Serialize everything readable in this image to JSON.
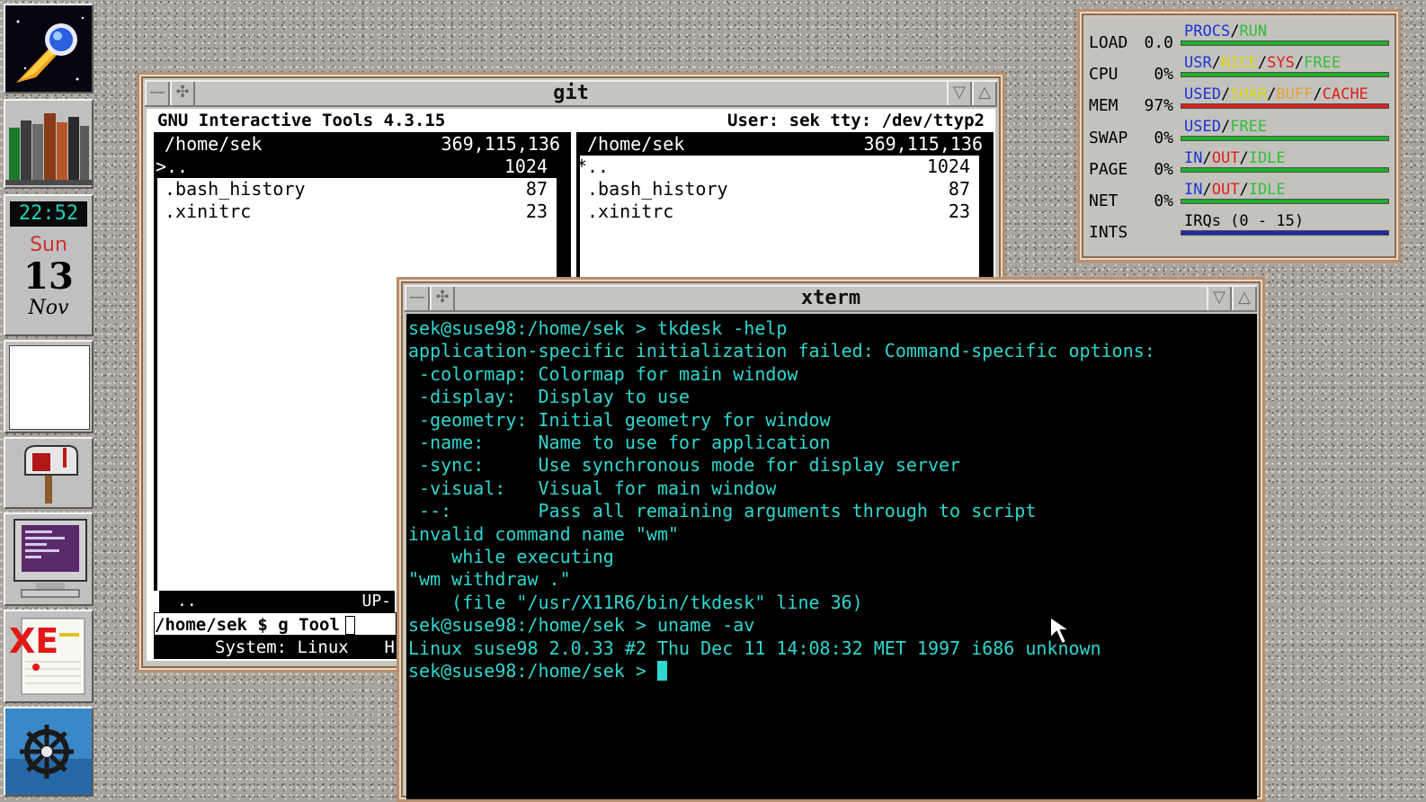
{
  "dock": {
    "clock_time": "22:52",
    "calendar": {
      "day": "Sun",
      "date": "13",
      "month": "Nov"
    },
    "icons": [
      "comet-icon",
      "books-icon",
      "clock-icon",
      "blank-tile",
      "mailbox-icon",
      "monitor-icon",
      "xemacs-icon",
      "ship-wheel-icon"
    ]
  },
  "git_window": {
    "title": "git",
    "header_left": "GNU Interactive Tools 4.3.15",
    "header_right": "User: sek  tty: /dev/ttyp2",
    "left_panel": {
      "path": "/home/sek",
      "size": "369,115,136",
      "marker": ">",
      "files": [
        {
          "name": "..",
          "size": "1024"
        },
        {
          "name": ".bash_history",
          "size": "87"
        },
        {
          "name": ".xinitrc",
          "size": "23"
        }
      ],
      "footer_left": "..",
      "footer_right": "UP-"
    },
    "right_panel": {
      "path": "/home/sek",
      "size": "369,115,136",
      "marker": "*",
      "files": [
        {
          "name": "..",
          "size": "1024"
        },
        {
          "name": ".bash_history",
          "size": "87"
        },
        {
          "name": ".xinitrc",
          "size": "23"
        }
      ]
    },
    "command_line": "/home/sek $ g Tool",
    "status_line": "System: Linux",
    "status_tail": "H"
  },
  "xterm_window": {
    "title": "xterm",
    "lines": [
      "sek@suse98:/home/sek > tkdesk -help",
      "application-specific initialization failed: Command-specific options:",
      " -colormap: Colormap for main window",
      " -display:  Display to use",
      " -geometry: Initial geometry for window",
      " -name:     Name to use for application",
      " -sync:     Use synchronous mode for display server",
      " -visual:   Visual for main window",
      " --:        Pass all remaining arguments through to script",
      "invalid command name \"wm\"",
      "    while executing",
      "\"wm withdraw .\"",
      "    (file \"/usr/X11R6/bin/tkdesk\" line 36)",
      "sek@suse98:/home/sek > uname -av",
      "Linux suse98 2.0.33 #2 Thu Dec 11 14:08:32 MET 1997 i686 unknown"
    ],
    "prompt": "sek@suse98:/home/sek > "
  },
  "monitor": {
    "rows": [
      {
        "label": "LOAD",
        "value": "0.0",
        "legend": [
          {
            "t": "PROCS",
            "c": "#1b34d6"
          },
          {
            "t": "/",
            "c": "#000000"
          },
          {
            "t": "RUN",
            "c": "#2fbf3a"
          }
        ],
        "bar": "#1db02d"
      },
      {
        "label": "CPU",
        "value": "0%",
        "legend": [
          {
            "t": "USR",
            "c": "#1b34d6"
          },
          {
            "t": "/",
            "c": "#000000"
          },
          {
            "t": "NICE",
            "c": "#d8d818"
          },
          {
            "t": "/",
            "c": "#000000"
          },
          {
            "t": "SYS",
            "c": "#e0201e"
          },
          {
            "t": "/",
            "c": "#000000"
          },
          {
            "t": "FREE",
            "c": "#2fbf3a"
          }
        ],
        "bar": "#1db02d"
      },
      {
        "label": "MEM",
        "value": "97%",
        "legend": [
          {
            "t": "USED",
            "c": "#1b34d6"
          },
          {
            "t": "/",
            "c": "#000000"
          },
          {
            "t": "SHAR",
            "c": "#d8d818"
          },
          {
            "t": "/",
            "c": "#000000"
          },
          {
            "t": "BUFF",
            "c": "#e2a23a"
          },
          {
            "t": "/",
            "c": "#000000"
          },
          {
            "t": "CACHE",
            "c": "#e0201e"
          }
        ],
        "bar": "#d42020"
      },
      {
        "label": "SWAP",
        "value": "0%",
        "legend": [
          {
            "t": "USED",
            "c": "#1b34d6"
          },
          {
            "t": "/",
            "c": "#000000"
          },
          {
            "t": "FREE",
            "c": "#2fbf3a"
          }
        ],
        "bar": "#1db02d"
      },
      {
        "label": "PAGE",
        "value": "0%",
        "legend": [
          {
            "t": "IN",
            "c": "#1b34d6"
          },
          {
            "t": "/",
            "c": "#000000"
          },
          {
            "t": "OUT",
            "c": "#e0201e"
          },
          {
            "t": "/",
            "c": "#000000"
          },
          {
            "t": "IDLE",
            "c": "#2fbf3a"
          }
        ],
        "bar": "#1db02d"
      },
      {
        "label": "NET",
        "value": "0%",
        "legend": [
          {
            "t": "IN",
            "c": "#1b34d6"
          },
          {
            "t": "/",
            "c": "#000000"
          },
          {
            "t": "OUT",
            "c": "#e0201e"
          },
          {
            "t": "/",
            "c": "#000000"
          },
          {
            "t": "IDLE",
            "c": "#2fbf3a"
          }
        ],
        "bar": "#1db02d"
      },
      {
        "label": "INTS",
        "value": "",
        "legend": [
          {
            "t": "IRQs (0 - 15)",
            "c": "#000000"
          }
        ],
        "bar": "#1f2aa8"
      }
    ]
  },
  "colors": {
    "terminal_fg": "#2fd7d0",
    "terminal_bg": "#000000",
    "frame": "#b98f6c"
  }
}
